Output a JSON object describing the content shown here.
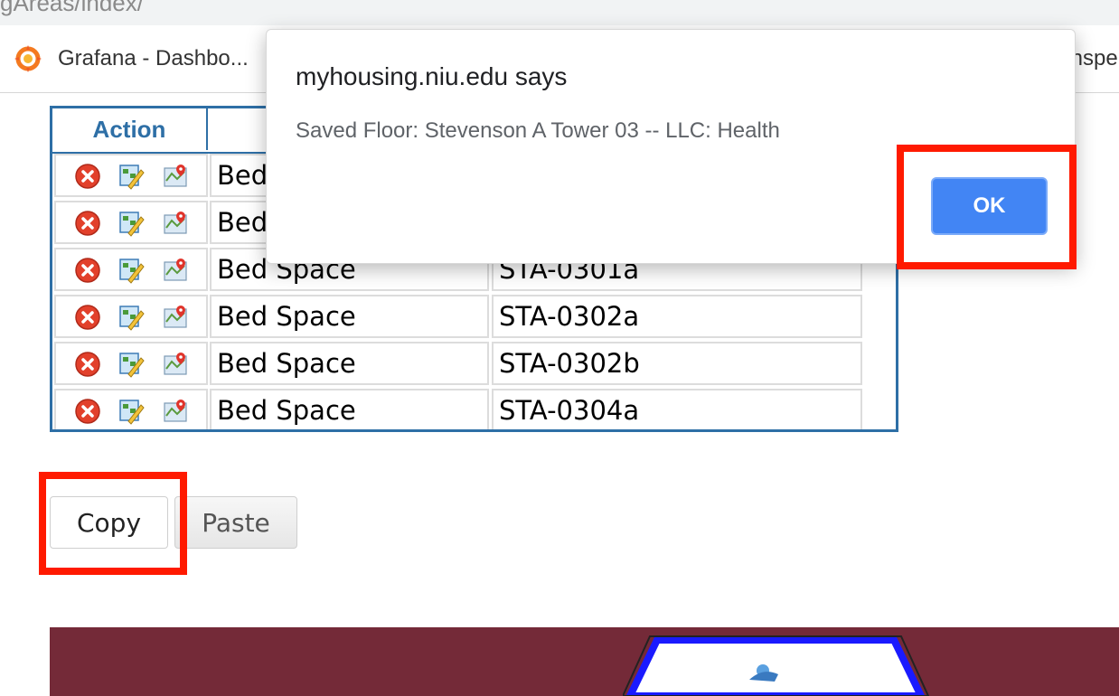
{
  "browser": {
    "url_fragment": "gAreas/index/",
    "bookmarks": [
      {
        "label": "Grafana - Dashbo...",
        "icon": "grafana-icon"
      },
      {
        "label": "Inspe"
      }
    ]
  },
  "table": {
    "headers": {
      "action": "Action"
    },
    "rows": [
      {
        "type": "Bed",
        "code": ""
      },
      {
        "type": "Bed",
        "code": ""
      },
      {
        "type": "Bed Space",
        "code": "STA-0301a"
      },
      {
        "type": "Bed Space",
        "code": "STA-0302a"
      },
      {
        "type": "Bed Space",
        "code": "STA-0302b"
      },
      {
        "type": "Bed Space",
        "code": "STA-0304a"
      }
    ]
  },
  "buttons": {
    "copy": "Copy",
    "paste": "Paste"
  },
  "dialog": {
    "title": "myhousing.niu.edu says",
    "message": "Saved Floor: Stevenson A Tower 03 -- LLC: Health",
    "ok": "OK"
  },
  "colors": {
    "table_border": "#2e6fa6",
    "highlight": "#ff1a00",
    "ok_button": "#4285f4",
    "banner": "#742a38"
  }
}
